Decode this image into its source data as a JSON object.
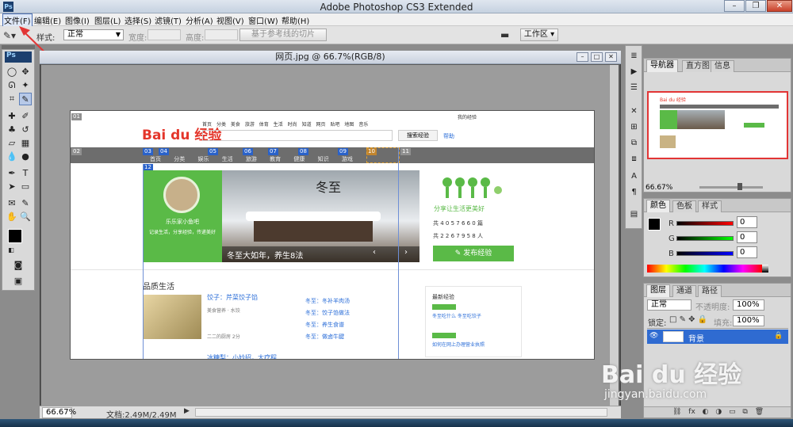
{
  "window": {
    "title": "Adobe Photoshop CS3 Extended",
    "app_icon": "Ps"
  },
  "menubar": {
    "items": [
      "文件(F)",
      "编辑(E)",
      "图像(I)",
      "图层(L)",
      "选择(S)",
      "滤镜(T)",
      "分析(A)",
      "视图(V)",
      "窗口(W)",
      "帮助(H)"
    ]
  },
  "options": {
    "style_label": "样式:",
    "style_value": "正常",
    "width_label": "宽度:",
    "height_label": "高度:",
    "guide_button": "基于参考线的切片",
    "workspace_label": "工作区"
  },
  "document": {
    "title": "网页.jpg @ 66.7%(RGB/8)",
    "zoom": "66.67%",
    "doc_info": "文档:2.49M/2.49M"
  },
  "webpage": {
    "logo": "Bai du 经验",
    "nav_links": [
      "首页",
      "分类",
      "美食",
      "旅游",
      "体育",
      "生活",
      "时尚",
      "知道",
      "网页",
      "贴吧",
      "地图",
      "音乐"
    ],
    "search_button": "搜索经验",
    "help_link": "帮助",
    "login_text": "我的经验",
    "category_tabs": [
      "首页",
      "分类",
      "娱乐",
      "生活",
      "旅游",
      "教育",
      "健康",
      "知识",
      "游戏"
    ],
    "slide_title": "冬至",
    "slide_caption": "冬至大如年，养生8法",
    "profile_name": "乐乐家小鱼吧",
    "profile_quote": "记录生活，分享经验，传递美好",
    "slogan": "分享让生活更美好",
    "counters": [
      "共 4 0 5 7 6 6 0 篇",
      "共 2 2 6 7 9 5 8 人"
    ],
    "publish_button": "发布经验",
    "section_title": "品质生活",
    "articles": [
      {
        "title": "饺子：芹菜饺子馅",
        "meta": "美食营养 · 水饺",
        "author": "二二的厨房 2分"
      },
      {
        "title": "冰糖梨：小妙招，大疗程",
        "meta": "",
        "author": ""
      }
    ],
    "list_items": [
      "冬至：冬补羊肉汤",
      "冬至：饺子馅做法",
      "冬至：养生食谱",
      "冬至：做卤牛腱"
    ],
    "sidebar_title": "最新经验",
    "sidebar_items": [
      "冬至吃什么 冬至吃饺子",
      "如何在网上办理营业执照"
    ],
    "slice_labels": [
      "01",
      "02",
      "03",
      "04",
      "05",
      "06",
      "07",
      "08",
      "09",
      "10",
      "11",
      "12"
    ]
  },
  "navigator": {
    "tabs": [
      "导航器",
      "直方图",
      "信息"
    ],
    "zoom": "66.67%"
  },
  "color_panel": {
    "tabs": [
      "颜色",
      "色板",
      "样式"
    ],
    "labels": [
      "R",
      "G",
      "B"
    ],
    "values": [
      "0",
      "0",
      "0"
    ]
  },
  "layers_panel": {
    "tabs": [
      "图层",
      "通道",
      "路径"
    ],
    "blend": "正常",
    "opacity_label": "不透明度:",
    "opacity": "100%",
    "lock_label": "锁定:",
    "fill_label": "填充:",
    "fill": "100%",
    "layer_name": "背景"
  },
  "watermark": {
    "brand": "Bai du 经验",
    "url": "jingyan.baidu.com"
  },
  "colors": {
    "accent_blue": "#2f6bd1",
    "baidu_red": "#e4362b",
    "baidu_blue": "#2b6ed8",
    "green": "#5aba47",
    "arrow_red": "#e23535"
  }
}
